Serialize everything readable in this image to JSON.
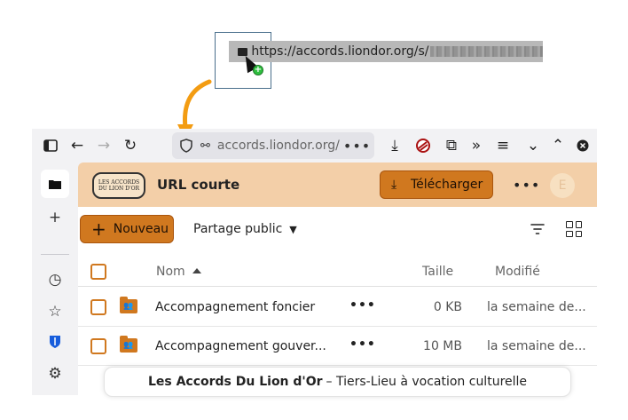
{
  "drag": {
    "url_visible": "https://accords.liondor.org/s/"
  },
  "browser": {
    "address_text": "accords.liondor.org/s",
    "address_more": "•••"
  },
  "app": {
    "logo_text_line1": "LES ACCORDS",
    "logo_text_line2": "DU LION D'OR",
    "title": "URL courte",
    "download_label": "Télécharger",
    "header_more": "•••",
    "avatar_letter": "E",
    "new_label": "Nouveau",
    "share_filter_label": "Partage public",
    "columns": {
      "name": "Nom",
      "size": "Taille",
      "modified": "Modifié"
    },
    "rows": [
      {
        "name": "Accompagnement foncier",
        "more": "•••",
        "size": "0 KB",
        "modified": "la semaine de..."
      },
      {
        "name": "Accompagnement gouver...",
        "more": "•••",
        "size": "10 MB",
        "modified": "la semaine de..."
      }
    ],
    "footer_bold": "Les Accords Du Lion d'Or",
    "footer_rest": "– Tiers-Lieu à vocation culturelle"
  },
  "colors": {
    "accent": "#d0781f",
    "header_bg": "#f3cfa8",
    "drag_arrow": "#f39c12"
  }
}
